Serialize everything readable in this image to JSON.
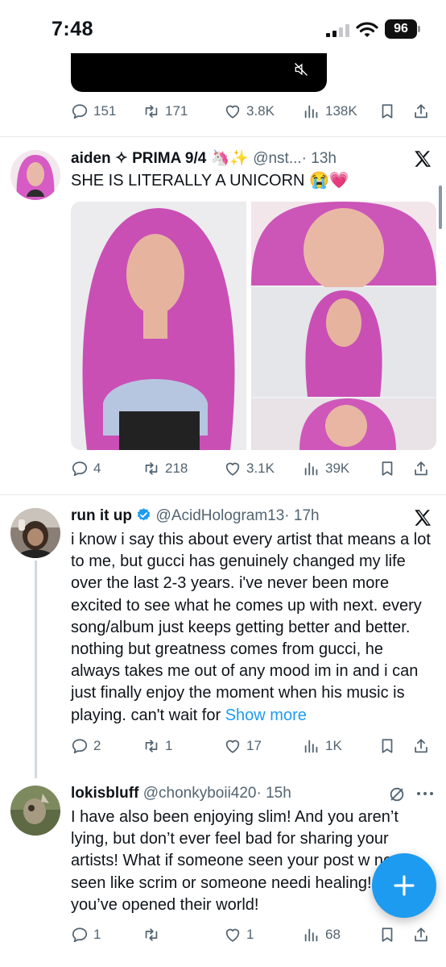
{
  "status_bar": {
    "time": "7:48",
    "battery": "96"
  },
  "tweet1_actions": {
    "replies": "151",
    "retweets": "171",
    "likes": "3.8K",
    "views": "138K"
  },
  "tweet2": {
    "name": "aiden ✧ PRIMA 9/4 🦄✨",
    "handle": "@nst...",
    "time": "· 13h",
    "text": "SHE IS LITERALLY A UNICORN 😭💗",
    "actions": {
      "replies": "4",
      "retweets": "218",
      "likes": "3.1K",
      "views": "39K"
    }
  },
  "tweet3": {
    "name": "run it up",
    "handle": "@AcidHologram13",
    "time": "· 17h",
    "text": "i know i say this about every artist that means a lot to me, but gucci has genuinely changed my life over the last 2-3 years. i've never been more excited to see what he comes up with next. every song/album just keeps getting better and better. nothing but greatness comes from gucci, he always takes me out of any mood im in and i can just finally enjoy the moment when his music is playing. can't wait for",
    "show_more": "Show more",
    "actions": {
      "replies": "2",
      "retweets": "1",
      "likes": "17",
      "views": "1K"
    }
  },
  "tweet4": {
    "name": "lokisbluff",
    "handle": "@chonkyboii420",
    "time": "· 15h",
    "text": "I have also been enjoying slim! And you aren’t lying, but don’t ever feel bad for sharing your artists! What if someone seen your post w never seen like scrim or someone needi healing! Now you’ve opened their world!",
    "actions": {
      "replies": "1",
      "retweets": "",
      "likes": "1",
      "views": "68"
    }
  },
  "colors": {
    "accent": "#1d9bf0",
    "muted": "#536471",
    "text": "#0f1419"
  },
  "icons": [
    "reply-icon",
    "retweet-icon",
    "like-icon",
    "views-icon",
    "bookmark-icon",
    "share-icon",
    "x-logo-icon",
    "verified-icon",
    "grok-icon",
    "more-icon",
    "mute-icon",
    "compose-icon"
  ]
}
